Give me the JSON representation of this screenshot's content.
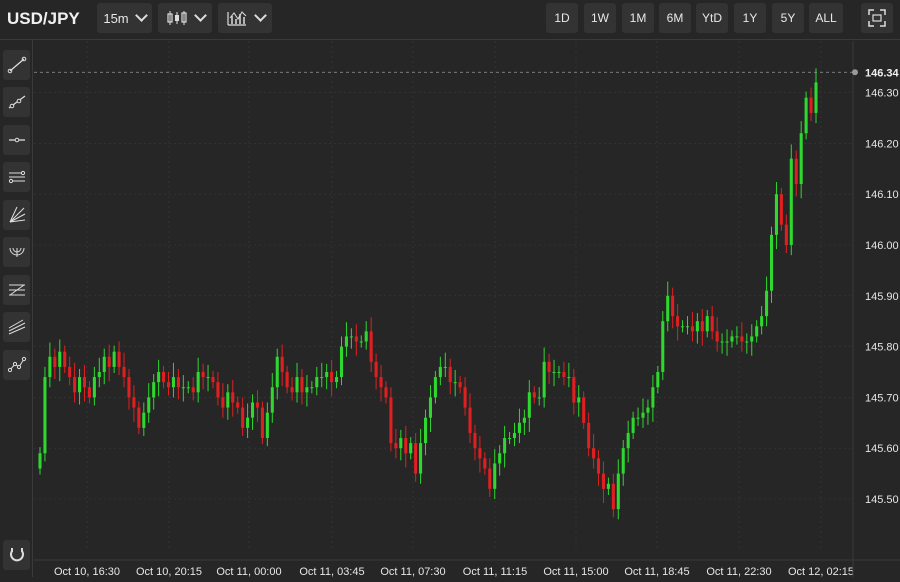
{
  "symbol": "USD/JPY",
  "interval": "15m",
  "ranges": [
    "1D",
    "1W",
    "1M",
    "6M",
    "YtD",
    "1Y",
    "5Y",
    "ALL"
  ],
  "colors": {
    "up": "#2ed82e",
    "down": "#e02020",
    "bg": "#262626",
    "grid": "#3a3a3a",
    "text": "#e6e6e6"
  },
  "icons": {
    "chart_type": "candlestick-icon",
    "indicators": "indicators-icon",
    "fullscreen": "fullscreen-icon",
    "tools": [
      "trend-line-icon",
      "ray-icon",
      "horizontal-line-icon",
      "parallel-channel-icon",
      "fan-icon",
      "arc-icon",
      "fibonacci-icon",
      "pitchfork-icon",
      "polyline-icon",
      "magnet-icon"
    ]
  },
  "chart_data": {
    "type": "candlestick",
    "x_tick_labels": [
      "Oct 10, 16:30",
      "Oct 10, 20:15",
      "Oct 11, 00:00",
      "Oct 11, 03:45",
      "Oct 11, 07:30",
      "Oct 11, 11:15",
      "Oct 11, 15:00",
      "Oct 11, 18:45",
      "Oct 11, 22:30",
      "Oct 12, 02:15"
    ],
    "y_ticks": [
      145.5,
      145.6,
      145.7,
      145.8,
      145.9,
      146.0,
      146.1,
      146.2,
      146.3
    ],
    "y_tick_labels": [
      "145.50",
      "145.60",
      "145.70",
      "145.80",
      "145.90",
      "146.00",
      "146.10",
      "146.20",
      "146.30"
    ],
    "ylim": [
      145.42,
      146.45
    ],
    "last_price": 146.34,
    "last_price_label": "146.34",
    "grid": true,
    "closes": [
      145.59,
      145.74,
      145.78,
      145.76,
      145.79,
      145.76,
      145.74,
      145.71,
      145.74,
      145.72,
      145.7,
      145.74,
      145.75,
      145.78,
      145.76,
      145.79,
      145.76,
      145.74,
      145.7,
      145.68,
      145.64,
      145.67,
      145.7,
      145.73,
      145.75,
      145.73,
      145.72,
      145.74,
      145.72,
      145.72,
      145.72,
      145.71,
      145.75,
      145.74,
      145.74,
      145.73,
      145.7,
      145.68,
      145.71,
      145.69,
      145.68,
      145.64,
      145.66,
      145.69,
      145.68,
      145.62,
      145.67,
      145.72,
      145.78,
      145.75,
      145.72,
      145.71,
      145.74,
      145.71,
      145.72,
      145.72,
      145.74,
      145.74,
      145.75,
      145.73,
      145.74,
      145.8,
      145.82,
      145.82,
      145.81,
      145.81,
      145.83,
      145.77,
      145.74,
      145.72,
      145.7,
      145.61,
      145.6,
      145.62,
      145.59,
      145.61,
      145.55,
      145.61,
      145.66,
      145.7,
      145.74,
      145.76,
      145.76,
      145.73,
      145.73,
      145.72,
      145.68,
      145.63,
      145.6,
      145.58,
      145.56,
      145.52,
      145.57,
      145.59,
      145.62,
      145.62,
      145.63,
      145.65,
      145.66,
      145.71,
      145.7,
      145.7,
      145.77,
      145.75,
      145.75,
      145.75,
      145.74,
      145.74,
      145.69,
      145.7,
      145.65,
      145.6,
      145.58,
      145.55,
      145.52,
      145.53,
      145.48,
      145.55,
      145.6,
      145.63,
      145.66,
      145.66,
      145.67,
      145.68,
      145.72,
      145.75,
      145.85,
      145.9,
      145.86,
      145.84,
      145.84,
      145.84,
      145.83,
      145.85,
      145.83,
      145.86,
      145.83,
      145.81,
      145.81,
      145.81,
      145.82,
      145.82,
      145.81,
      145.81,
      145.82,
      145.84,
      145.86,
      145.91,
      146.02,
      146.1,
      146.04,
      146.0,
      146.17,
      146.12,
      146.22,
      146.29,
      146.26,
      146.32
    ]
  }
}
